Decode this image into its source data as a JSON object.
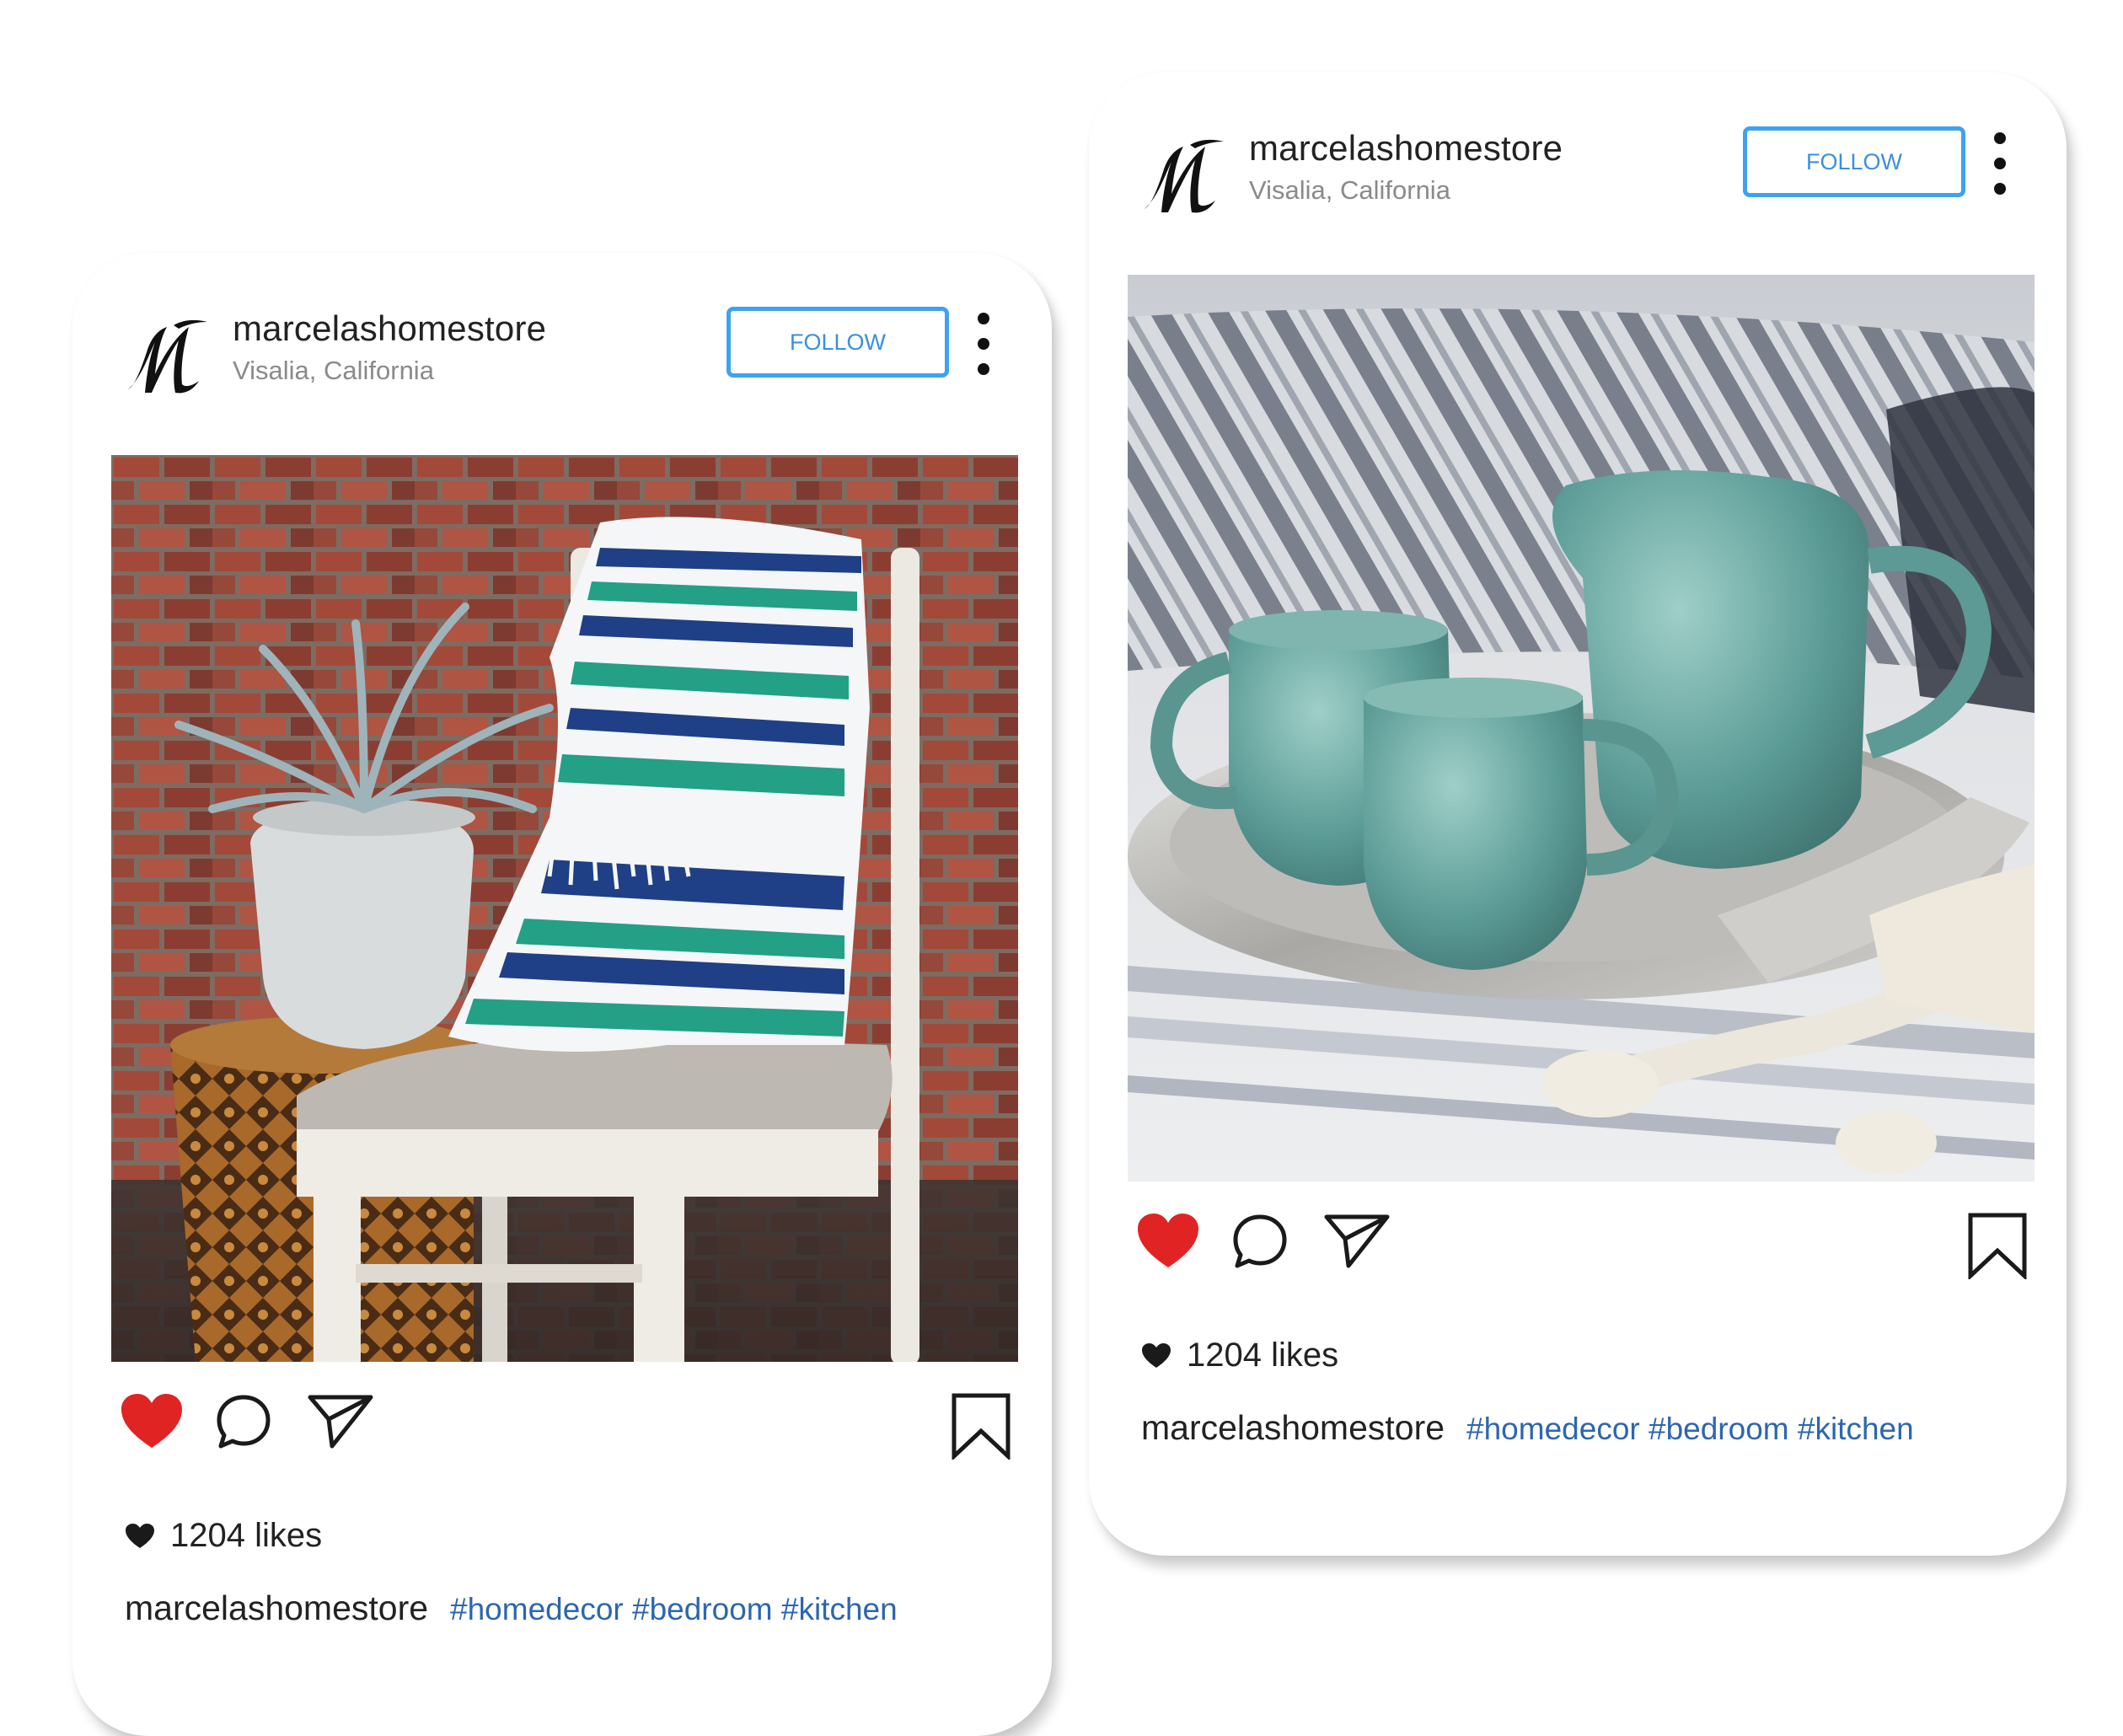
{
  "colors": {
    "follow_border": "#3fa2ef",
    "follow_text": "#3a8fdf",
    "heart_red": "#e02424",
    "hashtag_blue": "#2c66b0",
    "location_gray": "#8a8a8a"
  },
  "posts": [
    {
      "username": "marcelashomestore",
      "location": "Visalia, California",
      "follow_label": "FOLLOW",
      "likes": "1204 likes",
      "caption_user": "marcelashomestore",
      "hashtags": "#homedecor #bedroom #kitchen",
      "photo_subject": "chair-with-striped-blanket-and-plant"
    },
    {
      "username": "marcelashomestore",
      "location": "Visalia, California",
      "follow_label": "FOLLOW",
      "likes": "1204 likes",
      "caption_user": "marcelashomestore",
      "hashtags": "#homedecor #bedroom #kitchen",
      "photo_subject": "teal-mugs-and-pitcher-on-tray"
    }
  ],
  "icons": {
    "logo": "store-logo-m-icon",
    "more": "more-vertical-icon",
    "like": "heart-icon",
    "comment": "comment-icon",
    "share": "send-icon",
    "save": "bookmark-icon",
    "likes_small": "small-heart-icon"
  }
}
